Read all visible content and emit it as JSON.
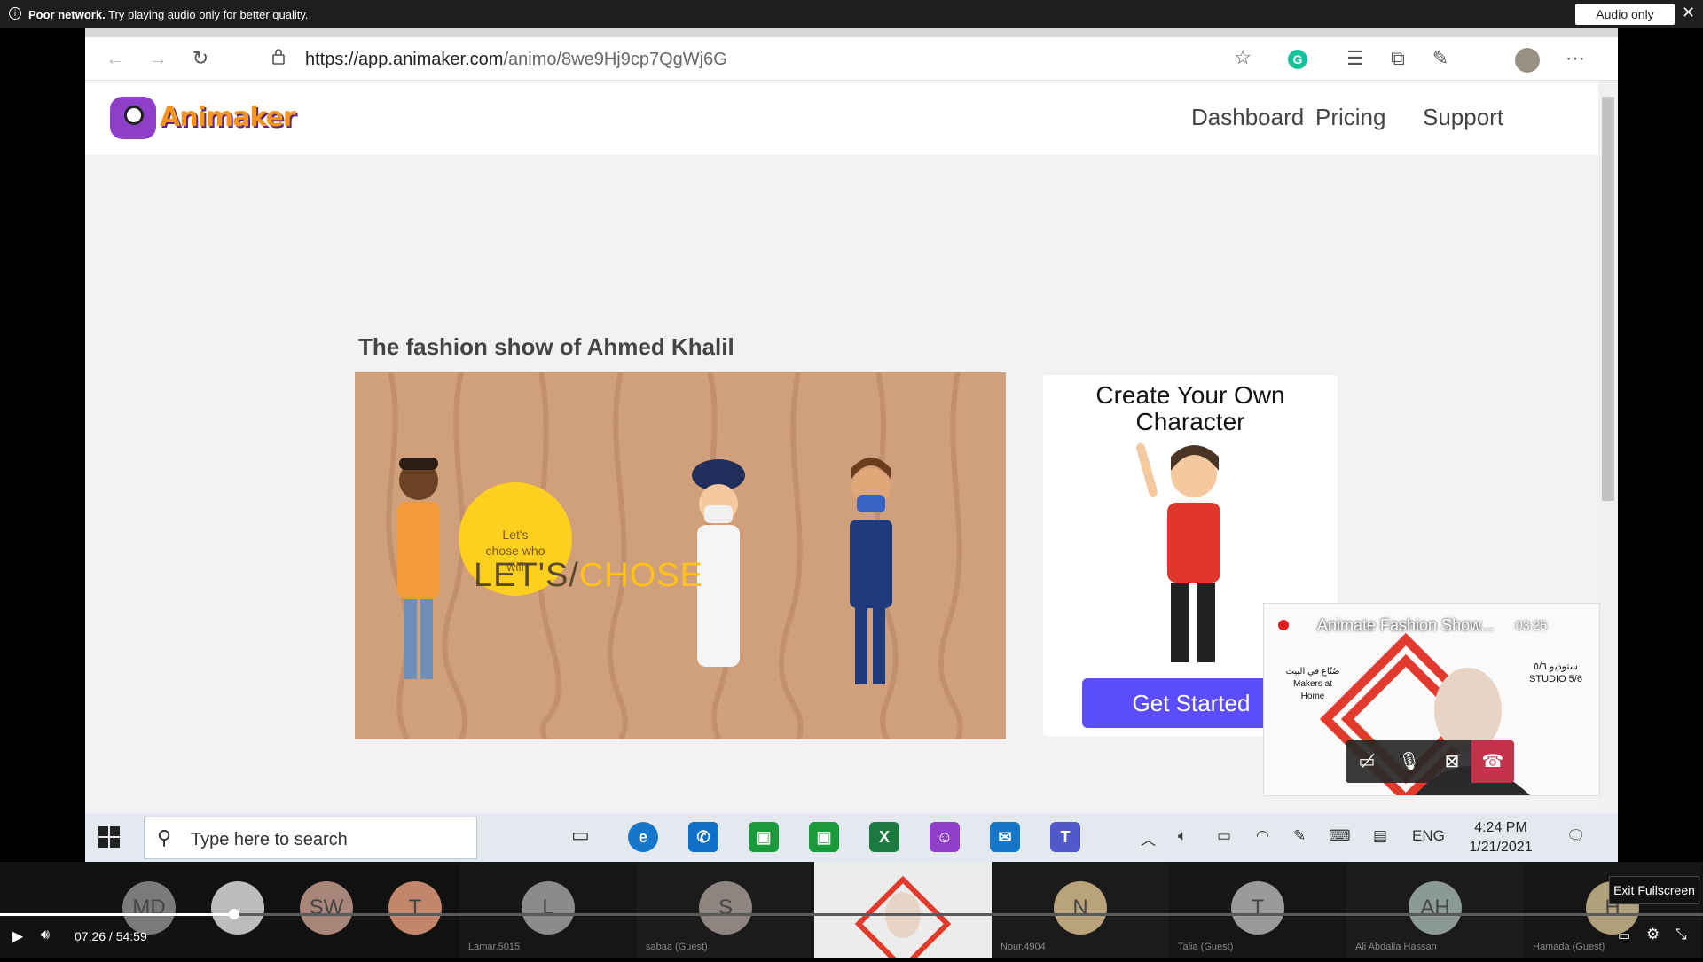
{
  "notification": {
    "bold": "Poor network.",
    "text": "Try playing audio only for better quality.",
    "button": "Audio only",
    "close": "✕"
  },
  "browser": {
    "url_host": "https://app.animaker.com",
    "url_path": "/animo/8we9Hj9cp7QgWj6G"
  },
  "site": {
    "logo_text": "Animaker",
    "nav": [
      "Dashboard",
      "Pricing",
      "Support"
    ],
    "page_title": "The fashion show of Ahmed Khalil",
    "video": {
      "bubble_small": "Let's chose who will",
      "bubble_big_1": "LET'S",
      "bubble_slash": "/",
      "bubble_big_2": "CHOSE"
    },
    "cta": {
      "title": "Create Your Own Character",
      "button": "Get Started"
    }
  },
  "taskbar": {
    "search_placeholder": "Type here to search",
    "lang": "ENG",
    "time": "4:24 PM",
    "date": "1/21/2021"
  },
  "pip": {
    "title": "Animate Fashion Show...",
    "time": "03:25",
    "logo_left_ar": "صُنّاع في البيت",
    "logo_left_en": "Makers at Home",
    "logo_right_ar": "ستوديو ٥/٦",
    "logo_right_en": "STUDIO 5/6"
  },
  "participants": [
    {
      "initials": "MD",
      "name": "",
      "color": "#7a7a7a"
    },
    {
      "initials": "",
      "name": "",
      "color": "#bdbdbd"
    },
    {
      "initials": "SW",
      "name": "",
      "color": "#a8867a"
    },
    {
      "initials": "T",
      "name": "",
      "color": "#c1866b"
    },
    {
      "initials": "L",
      "name": "Lamar.5015",
      "color": "#8b8b8b"
    },
    {
      "initials": "S",
      "name": "sabaa (Guest)",
      "color": "#8f8580"
    },
    {
      "initials": "",
      "name": "",
      "color": "#fff"
    },
    {
      "initials": "N",
      "name": "Nour.4904",
      "color": "#b8a37a"
    },
    {
      "initials": "T",
      "name": "Talia (Guest)",
      "color": "#9a9a9a"
    },
    {
      "initials": "AH",
      "name": "Ali Abdalla Hassan",
      "color": "#8c9a96"
    },
    {
      "initials": "H",
      "name": "Hamada (Guest)",
      "color": "#b0a07a"
    }
  ],
  "player": {
    "time": "07:26  /  54:59",
    "exit_fullscreen": "Exit Fullscreen"
  },
  "colors": {
    "accent": "#5b4dfa",
    "logo_orange": "#f7941d",
    "logo_purple": "#8e3fc9",
    "video_bg": "#d0a07c"
  }
}
